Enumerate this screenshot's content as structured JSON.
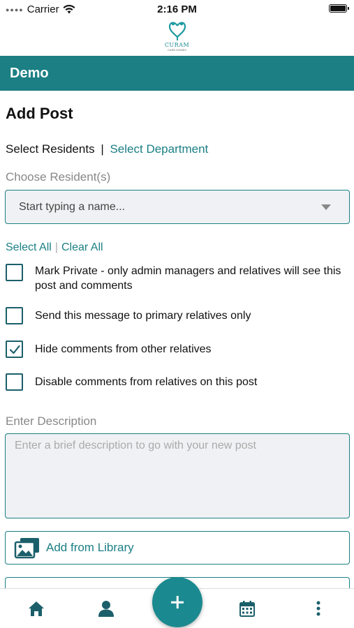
{
  "status_bar": {
    "carrier": "Carrier",
    "time": "2:16 PM"
  },
  "logo": {
    "wordmark": "CURAM",
    "subtitle": "CARE HOMES"
  },
  "app_bar": {
    "title": "Demo"
  },
  "page": {
    "title": "Add Post"
  },
  "target_tabs": {
    "residents": "Select Residents",
    "separator": "|",
    "department": "Select Department"
  },
  "residents_field": {
    "label": "Choose Resident(s)",
    "placeholder": "Start typing a name..."
  },
  "bulk_select": {
    "select_all": "Select All",
    "separator": "|",
    "clear_all": "Clear All"
  },
  "options": [
    {
      "label": "Mark Private - only admin managers and relatives will see this post and comments",
      "checked": false
    },
    {
      "label": "Send this message to primary relatives only",
      "checked": false
    },
    {
      "label": "Hide comments from other relatives",
      "checked": true
    },
    {
      "label": "Disable comments from relatives on this post",
      "checked": false
    }
  ],
  "description": {
    "label": "Enter Description",
    "placeholder": "Enter a brief description to go with your new post"
  },
  "media": {
    "library_label": "Add from Library"
  },
  "bottom_nav": {
    "items": [
      "home-icon",
      "user-icon",
      "add-icon",
      "calendar-icon",
      "more-icon"
    ]
  },
  "colors": {
    "accent": "#1b7f84",
    "field_bg": "#eff1f4"
  }
}
